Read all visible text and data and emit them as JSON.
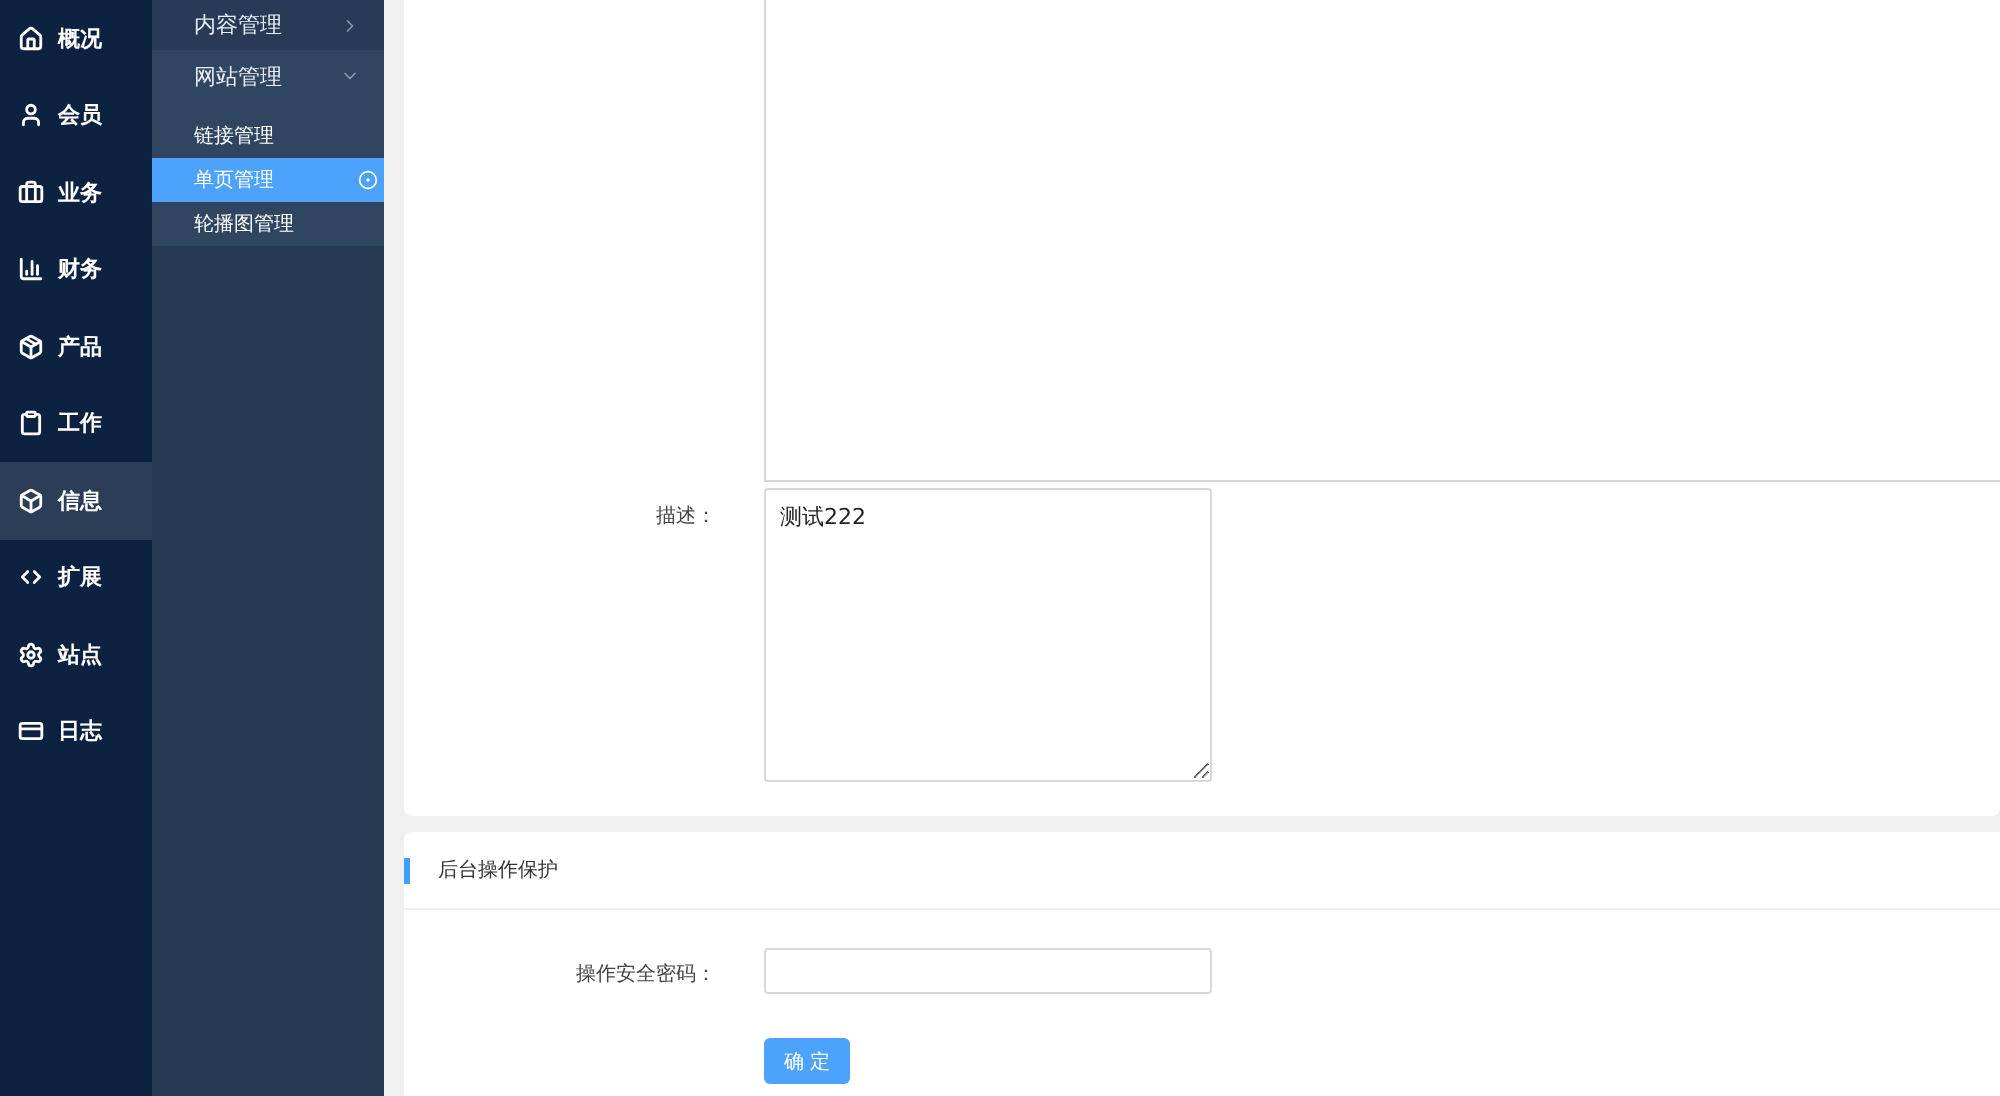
{
  "rail": [
    {
      "label": "概况",
      "selected": false
    },
    {
      "label": "会员",
      "selected": false
    },
    {
      "label": "业务",
      "selected": false
    },
    {
      "label": "财务",
      "selected": false
    },
    {
      "label": "产品",
      "selected": false
    },
    {
      "label": "工作",
      "selected": false
    },
    {
      "label": "信息",
      "selected": true
    },
    {
      "label": "扩展",
      "selected": false
    },
    {
      "label": "站点",
      "selected": false
    },
    {
      "label": "日志",
      "selected": false
    }
  ],
  "submenu": [
    {
      "label": "内容管理",
      "expanded": false
    },
    {
      "label": "网站管理",
      "expanded": true,
      "children": [
        {
          "label": "链接管理",
          "selected": false
        },
        {
          "label": "单页管理",
          "selected": true
        },
        {
          "label": "轮播图管理",
          "selected": false
        }
      ]
    }
  ],
  "form": {
    "description_label": "描述：",
    "description_value": "测试222"
  },
  "protection": {
    "title": "后台操作保护",
    "password_label": "操作安全密码：",
    "confirm_button": "确 定"
  }
}
